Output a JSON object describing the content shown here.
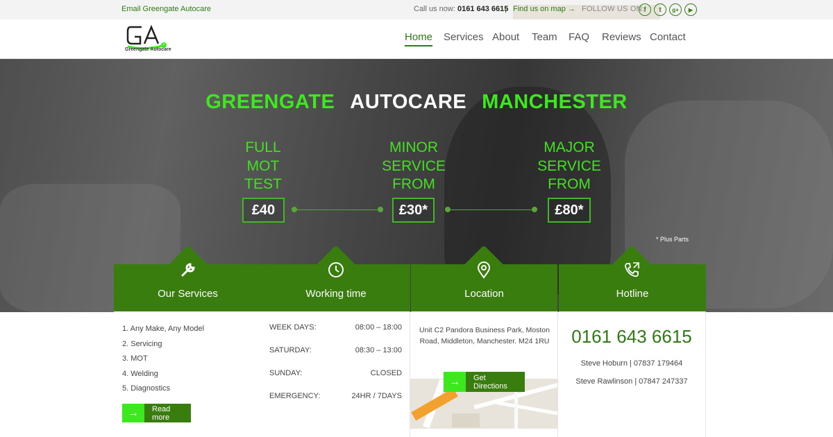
{
  "topbar": {
    "email_label": "Email Greengate Autocare",
    "call_prefix": "Call us now:",
    "call_number": "0161 643 6615",
    "separator": "|",
    "find_map": "Find us on map →",
    "follow_label": "FOLLOW US ON:",
    "social": [
      {
        "name": "facebook",
        "glyph": "f"
      },
      {
        "name": "twitter",
        "glyph": "t"
      },
      {
        "name": "google-plus",
        "glyph": "g+"
      },
      {
        "name": "youtube",
        "glyph": "▶"
      }
    ]
  },
  "header": {
    "logo_text": "Greengate Autocare",
    "nav": [
      {
        "label": "Home",
        "active": true
      },
      {
        "label": "Services"
      },
      {
        "label": "About"
      },
      {
        "label": "Team"
      },
      {
        "label": "FAQ"
      },
      {
        "label": "Reviews"
      },
      {
        "label": "Contact"
      }
    ]
  },
  "hero": {
    "title_left": "GREENGATE",
    "title_mid": "AUTOCARE",
    "title_right": "MANCHESTER",
    "offers": [
      {
        "line1": "FULL",
        "line2": "MOT",
        "line3": "TEST",
        "price": "£40"
      },
      {
        "line1": "MINOR",
        "line2": "SERVICE",
        "line3": "FROM",
        "price": "£30*"
      },
      {
        "line1": "MAJOR",
        "line2": "SERVICE",
        "line3": "FROM",
        "price": "£80*"
      }
    ],
    "plus_parts": "* Plus Parts"
  },
  "features": {
    "services": {
      "title": "Our Services",
      "icon": "wrench-icon",
      "items": [
        "1.  Any Make, Any Model",
        "2.  Servicing",
        "3.  MOT",
        "4.  Welding",
        "5.  Diagnostics"
      ],
      "button": "Read more"
    },
    "working": {
      "title": "Working time",
      "icon": "clock-icon",
      "rows": [
        {
          "day": "WEEK DAYS:",
          "hours": "08:00 – 18:00"
        },
        {
          "day": "SATURDAY:",
          "hours": "08:30 – 13:00"
        },
        {
          "day": "SUNDAY:",
          "hours": "CLOSED"
        },
        {
          "day": "EMERGENCY:",
          "hours": "24HR / 7DAYS"
        }
      ]
    },
    "location": {
      "title": "Location",
      "icon": "map-pin-icon",
      "address_line1": "Unit C2 Pandora Business Park, Moston",
      "address_line2": "Road, Middleton, Manchester. M24 1RU",
      "button": "Get Directions"
    },
    "hotline": {
      "title": "Hotline",
      "icon": "phone-icon",
      "number": "0161 643 6615",
      "contacts": [
        "Steve Hoburn | 07837 179464",
        "Steve Rawlinson | 07847 247337"
      ]
    }
  },
  "colors": {
    "brand_green": "#3a7d0f",
    "accent_green": "#3ee81f",
    "text_green": "#2f7a12"
  }
}
